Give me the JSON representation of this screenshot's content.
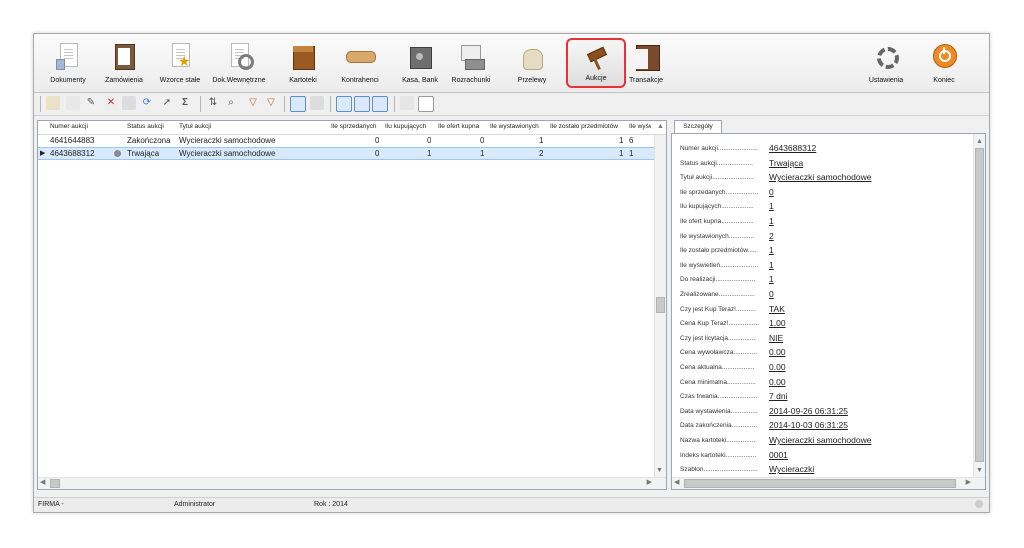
{
  "ribbon": {
    "items": [
      {
        "label": "Dokumenty"
      },
      {
        "label": "Zamówienia"
      },
      {
        "label": "Wzorce stałe"
      },
      {
        "label": "Dok.Wewnętrzne"
      },
      {
        "label": "Kartoteki"
      },
      {
        "label": "Kontrahenci"
      },
      {
        "label": "Kasa, Bank"
      },
      {
        "label": "Rozrachunki"
      },
      {
        "label": "Przelewy"
      },
      {
        "label": "Aukcje"
      },
      {
        "label": "Transakcje"
      }
    ],
    "settings_label": "Ustawienia",
    "exit_label": "Koniec"
  },
  "toolbar": {
    "sigma_label": "Σ"
  },
  "grid": {
    "columns": [
      "Numer aukcji",
      "Status aukcji",
      "Tytuł aukcji",
      "Ile sprzedanych",
      "Ilu kupujących",
      "Ile ofert kupna",
      "Ile wystawionych",
      "Ile zostało przedmiotów",
      "Ile wyśw"
    ],
    "rows": [
      {
        "numer": "4641644883",
        "status": "Zakończona",
        "tytul": "Wycieraczki samochodowe",
        "sprzedanych": "0",
        "kupujacych": "0",
        "ofert": "0",
        "wystawionych": "1",
        "zostalo": "1",
        "wysw": "6"
      },
      {
        "numer": "4643688312",
        "status": "Trwająca",
        "tytul": "Wycieraczki samochodowe",
        "sprzedanych": "0",
        "kupujacych": "1",
        "ofert": "1",
        "wystawionych": "2",
        "zostalo": "1",
        "wysw": "1"
      }
    ]
  },
  "details": {
    "tab_label": "Szczegóły",
    "fields": [
      {
        "label": "Numer aukcji......................",
        "value": "4643688312"
      },
      {
        "label": "Status aukcji....................",
        "value": "Trwająca"
      },
      {
        "label": "Tytuł aukcji.......................",
        "value": "Wycieraczki samochodowe"
      },
      {
        "label": "Ile sprzedanych..................",
        "value": "0"
      },
      {
        "label": "Ilu kupujących..................",
        "value": "1"
      },
      {
        "label": "Ile ofert kupna..................",
        "value": "1"
      },
      {
        "label": "Ile wystawionych..............",
        "value": "2"
      },
      {
        "label": "Ile zostało przedmiotów.....",
        "value": "1"
      },
      {
        "label": "Ile wyświetleń.....................",
        "value": "1"
      },
      {
        "label": "Do realizacji......................",
        "value": "1"
      },
      {
        "label": "Zrealizowane....................",
        "value": "0"
      },
      {
        "label": "Czy jest Kup Teraz!...........",
        "value": "TAK"
      },
      {
        "label": "Cena Kup Teraz!.................",
        "value": "1.00"
      },
      {
        "label": "Czy jest licytacja...............",
        "value": "NIE"
      },
      {
        "label": "Cena wywoławcza.............",
        "value": "0.00"
      },
      {
        "label": "Cena aktualna..................",
        "value": "0.00"
      },
      {
        "label": "Cena minimalna................",
        "value": "0.00"
      },
      {
        "label": "Czas trwania......................",
        "value": "7 dni"
      },
      {
        "label": "Data wystawienia...............",
        "value": "2014-09-26 06:31:25"
      },
      {
        "label": "Data zakończenia..............",
        "value": "2014-10-03 06:31:25"
      },
      {
        "label": "Nazwa kartoteki................",
        "value": "Wycieraczki samochodowe"
      },
      {
        "label": "Indeks kartoteki.................",
        "value": "0001"
      },
      {
        "label": "Szablon..............................",
        "value": "Wycieraczki"
      }
    ]
  },
  "status": {
    "firma": "FIRMA -",
    "user": "Administrator",
    "rok": "Rok : 2014"
  },
  "colors": {
    "accent_highlight": "#e8323a",
    "selection": "#d8e9fb"
  }
}
